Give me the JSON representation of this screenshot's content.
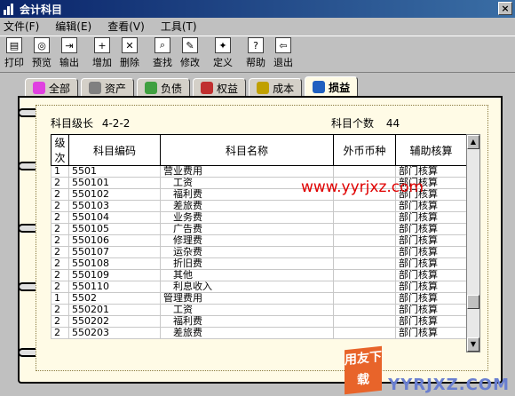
{
  "window": {
    "title": "会计科目",
    "close": "×"
  },
  "menu": [
    "文件(F)",
    "编辑(E)",
    "查看(V)",
    "工具(T)"
  ],
  "toolbar": [
    {
      "label": "打印",
      "icon": "printer-icon"
    },
    {
      "label": "预览",
      "icon": "preview-icon"
    },
    {
      "label": "输出",
      "icon": "export-icon"
    },
    {
      "label": "增加",
      "icon": "add-icon"
    },
    {
      "label": "删除",
      "icon": "delete-icon"
    },
    {
      "label": "查找",
      "icon": "find-icon"
    },
    {
      "label": "修改",
      "icon": "edit-icon"
    },
    {
      "label": "定义",
      "icon": "define-icon"
    },
    {
      "label": "帮助",
      "icon": "help-icon"
    },
    {
      "label": "退出",
      "icon": "exit-icon"
    }
  ],
  "tabs": [
    "全部",
    "资产",
    "负债",
    "权益",
    "成本",
    "损益"
  ],
  "active_tab": "损益",
  "info": {
    "level_label": "科目级长",
    "level_value": "4-2-2",
    "count_label": "科目个数",
    "count_value": "44"
  },
  "table": {
    "headers": [
      "级次",
      "科目编码",
      "科目名称",
      "外币币种",
      "辅助核算"
    ],
    "rows": [
      [
        "1",
        "5501",
        "营业费用",
        "",
        "部门核算"
      ],
      [
        "2",
        "550101",
        "　工资",
        "",
        "部门核算"
      ],
      [
        "2",
        "550102",
        "　福利费",
        "",
        "部门核算"
      ],
      [
        "2",
        "550103",
        "　差旅费",
        "",
        "部门核算"
      ],
      [
        "2",
        "550104",
        "　业务费",
        "",
        "部门核算"
      ],
      [
        "2",
        "550105",
        "　广告费",
        "",
        "部门核算"
      ],
      [
        "2",
        "550106",
        "　修理费",
        "",
        "部门核算"
      ],
      [
        "2",
        "550107",
        "　运杂费",
        "",
        "部门核算"
      ],
      [
        "2",
        "550108",
        "　折旧费",
        "",
        "部门核算"
      ],
      [
        "2",
        "550109",
        "　其他",
        "",
        "部门核算"
      ],
      [
        "2",
        "550110",
        "　利息收入",
        "",
        "部门核算"
      ],
      [
        "1",
        "5502",
        "管理费用",
        "",
        "部门核算"
      ],
      [
        "2",
        "550201",
        "　工资",
        "",
        "部门核算"
      ],
      [
        "2",
        "550202",
        "　福利费",
        "",
        "部门核算"
      ],
      [
        "2",
        "550203",
        "　差旅费",
        "",
        "部门核算"
      ]
    ]
  },
  "watermark": {
    "url": "www.yyrjxz.com",
    "logo": "用友下载",
    "brand": "YYRJXZ.COM"
  }
}
